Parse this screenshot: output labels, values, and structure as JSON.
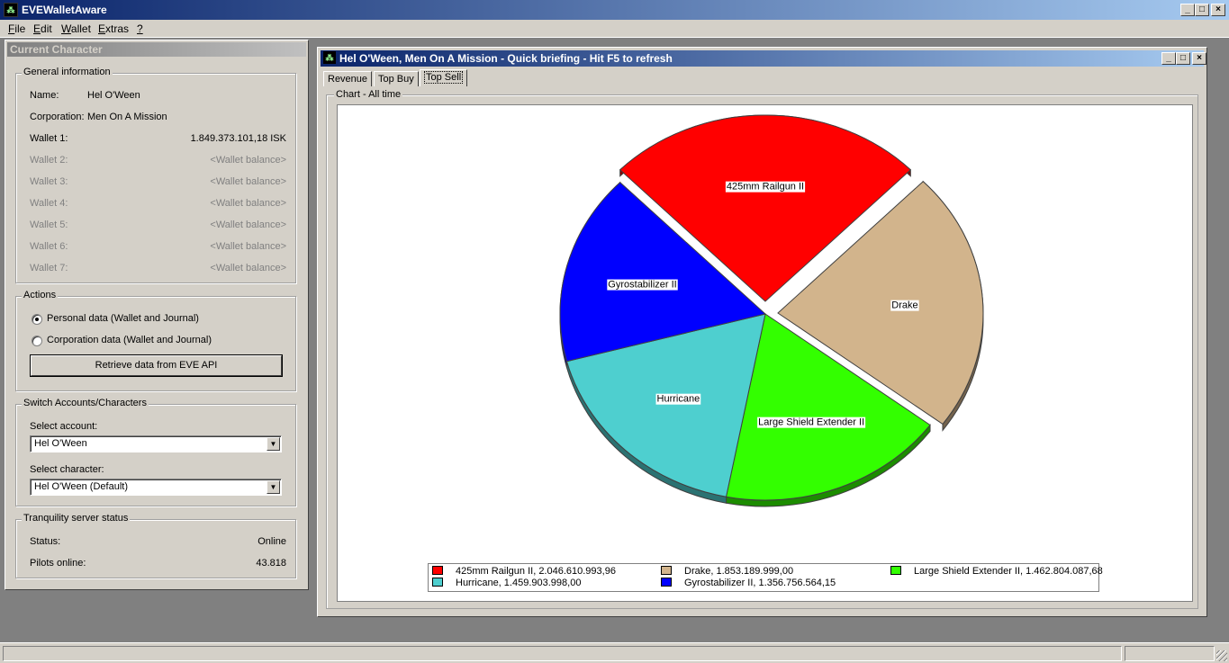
{
  "app": {
    "title": "EVEWalletAware"
  },
  "menu": [
    "File",
    "Edit",
    "Wallet",
    "Extras",
    "?"
  ],
  "left_panel": {
    "caption": "Current Character",
    "general": {
      "legend": "General information",
      "name_label": "Name:",
      "name_value": "Hel O'Ween",
      "corp_label": "Corporation:",
      "corp_value": "Men On A Mission",
      "wallets": [
        {
          "label": "Wallet 1:",
          "value": "1.849.373.101,18 ISK"
        },
        {
          "label": "Wallet 2:",
          "value": "<Wallet balance>"
        },
        {
          "label": "Wallet 3:",
          "value": "<Wallet balance>"
        },
        {
          "label": "Wallet 4:",
          "value": "<Wallet balance>"
        },
        {
          "label": "Wallet 5:",
          "value": "<Wallet balance>"
        },
        {
          "label": "Wallet 6:",
          "value": "<Wallet balance>"
        },
        {
          "label": "Wallet 7:",
          "value": "<Wallet balance>"
        }
      ]
    },
    "actions": {
      "legend": "Actions",
      "personal": "Personal data (Wallet and Journal)",
      "corporation": "Corporation data (Wallet and Journal)",
      "selected": "personal",
      "retrieve_button": "Retrieve data from EVE API"
    },
    "switch": {
      "legend": "Switch Accounts/Characters",
      "account_label": "Select account:",
      "account_value": "Hel O'Ween",
      "character_label": "Select character:",
      "character_value": "Hel O'Ween (Default)"
    },
    "server": {
      "legend": "Tranquility server status",
      "status_label": "Status:",
      "status_value": "Online",
      "pilots_label": "Pilots online:",
      "pilots_value": "43.818"
    }
  },
  "child_window": {
    "title": "Hel O'Ween, Men On A Mission - Quick briefing - Hit F5 to refresh",
    "tabs": [
      "Revenue",
      "Top Buy",
      "Top Sell"
    ],
    "active_tab": "Top Sell",
    "chart_frame_label": "Chart - All time"
  },
  "chart_data": {
    "type": "pie",
    "title": "",
    "slices": [
      {
        "label": "425mm Railgun II",
        "legend": "425mm Railgun II, 2.046.610.993,96",
        "value": 2046610993.96,
        "color": "#ff0000",
        "exploded": true
      },
      {
        "label": "Drake",
        "legend": "Drake, 1.853.189.999,00",
        "value": 1853189999.0,
        "color": "#d2b48c",
        "exploded": true
      },
      {
        "label": "Large Shield Extender II",
        "legend": "Large Shield Extender II, 1.462.804.087,68",
        "value": 1462804087.68,
        "color": "#33ff00",
        "exploded": false
      },
      {
        "label": "Hurricane",
        "legend": "Hurricane, 1.459.903.998,00",
        "value": 1459903998.0,
        "color": "#4ecfcf",
        "exploded": false
      },
      {
        "label": "Gyrostabilizer II",
        "legend": "Gyrostabilizer II, 1.356.756.564,15",
        "value": 1356756564.15,
        "color": "#0000ff",
        "exploded": false
      }
    ],
    "legend_position": "bottom"
  }
}
